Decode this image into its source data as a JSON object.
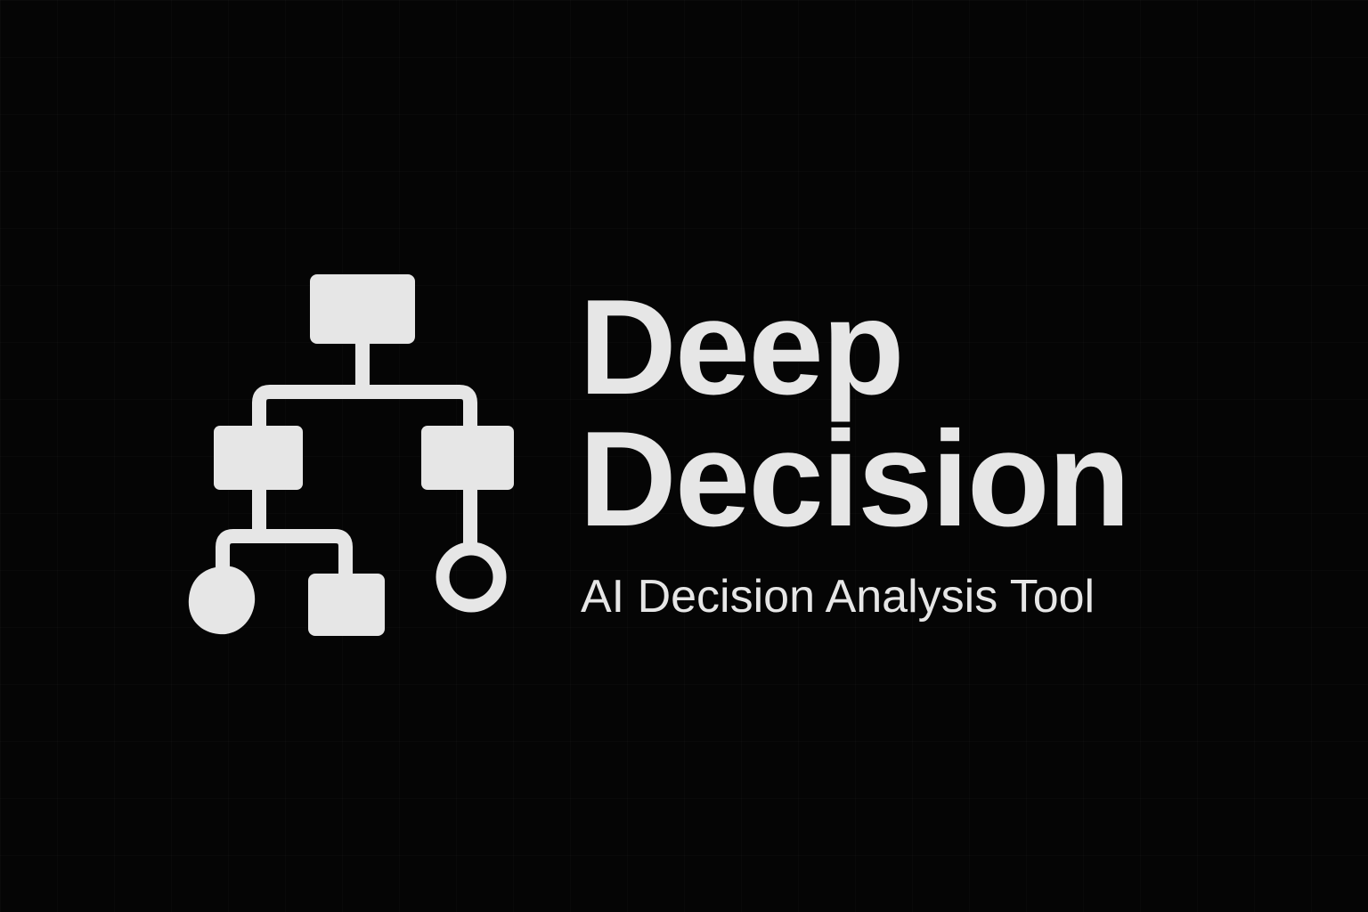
{
  "brand": {
    "title_line_1": "Deep",
    "title_line_2": "Decision",
    "tagline": "AI Decision Analysis Tool"
  },
  "logo": {
    "icon": "decision-tree-icon"
  },
  "colors": {
    "background": "#050505",
    "foreground": "#E6E6E6"
  }
}
